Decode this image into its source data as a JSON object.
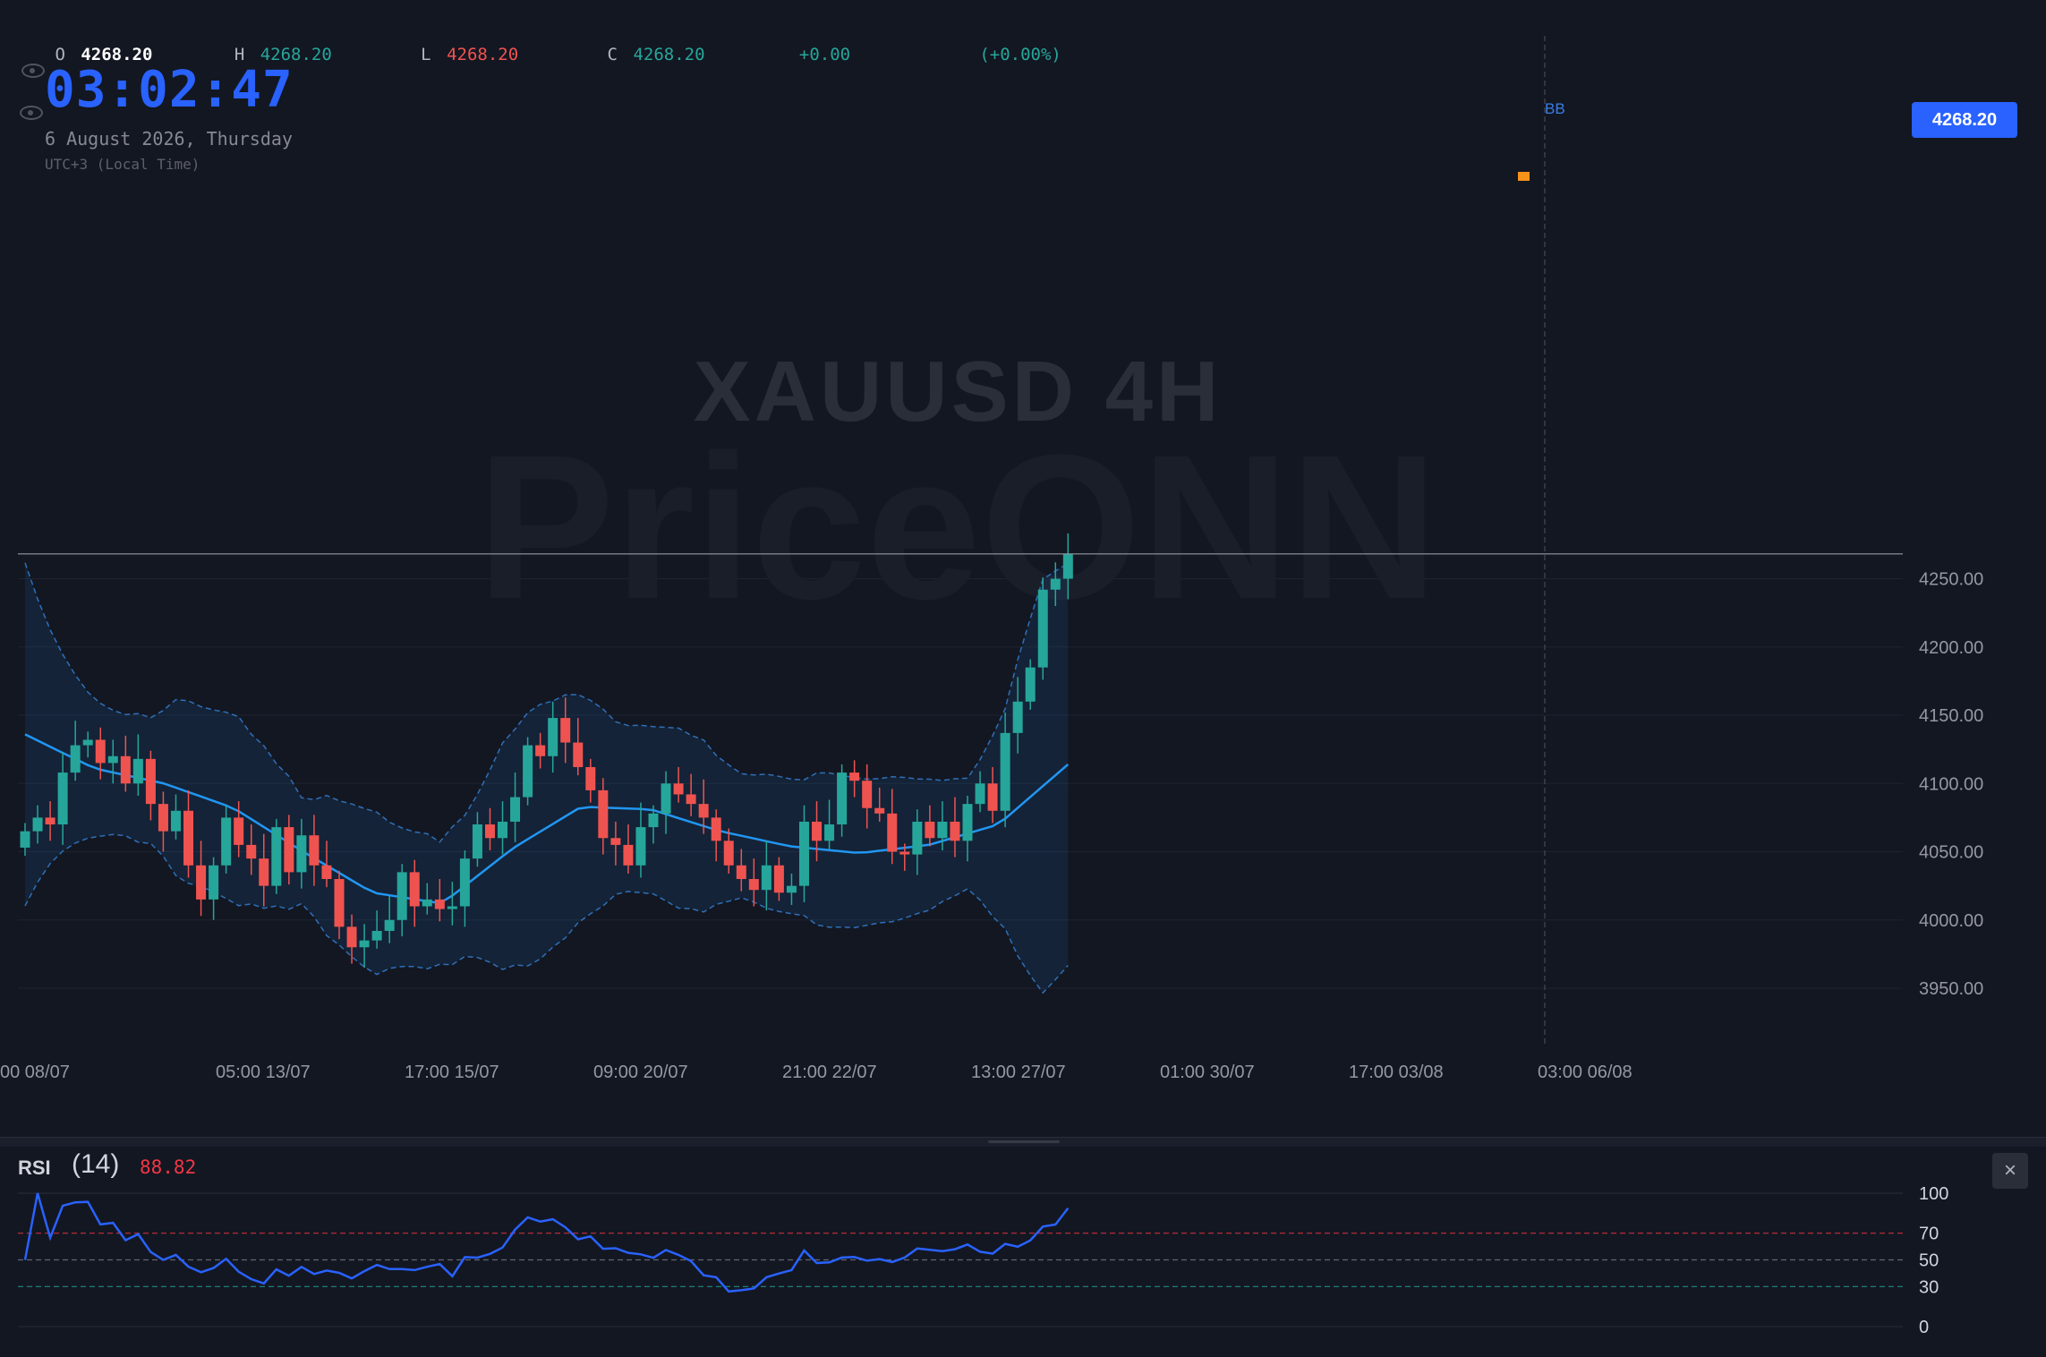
{
  "ohlc": {
    "o_label": "O",
    "o_value": "4268.20",
    "h_label": "H",
    "h_value": "4268.20",
    "l_label": "L",
    "l_value": "4268.20",
    "c_label": "C",
    "c_value": "4268.20",
    "change": "+0.00",
    "change_pct": "(+0.00%)"
  },
  "clock": "03:02:47",
  "date_line": "6 August 2026, Thursday",
  "timezone_line": "UTC+3 (Local Time)",
  "watermark": {
    "symbol": "XAUUSD 4H",
    "brand": "PriceONN"
  },
  "current_price_tag": "4268.20",
  "indicator_label": "BB",
  "rsi": {
    "label": "RSI",
    "length": "(14)",
    "value": "88.82"
  },
  "close_icon": "×",
  "colors": {
    "up": "#26a69a",
    "down": "#ef5350",
    "accent": "#2962ff",
    "rsi_line": "#2962ff",
    "basis": "#2196f3"
  },
  "chart_data": [
    {
      "type": "candlestick",
      "symbol": "XAUUSD",
      "timeframe": "4H",
      "ylim": [
        3925,
        4290
      ],
      "y_ticks": [
        3950,
        4000,
        4050,
        4100,
        4150,
        4200,
        4250
      ],
      "y_tick_labels": [
        "3950.00",
        "4000.00",
        "4050.00",
        "4100.00",
        "4150.00",
        "4200.00",
        "4250.00"
      ],
      "x_tick_labels": [
        "00 08/07",
        "05:00 13/07",
        "17:00 15/07",
        "09:00 20/07",
        "21:00 22/07",
        "13:00 27/07",
        "01:00 30/07",
        "17:00 03/08",
        "03:00 06/08"
      ],
      "last_price": 4268.2,
      "bollinger": {
        "basis": [
          4136,
          4111,
          4100,
          4082,
          4050,
          4020,
          4012,
          4052,
          4083,
          4081,
          4065,
          4054,
          4049,
          4055,
          4070,
          4114
        ]
      },
      "closes": [
        4065,
        4075,
        4070,
        4108,
        4128,
        4132,
        4115,
        4120,
        4100,
        4118,
        4085,
        4065,
        4080,
        4040,
        4015,
        4040,
        4075,
        4055,
        4045,
        4025,
        4068,
        4035,
        4062,
        4040,
        4030,
        3995,
        3980,
        3985,
        3992,
        4000,
        4035,
        4010,
        4015,
        4008,
        4010,
        4045,
        4070,
        4060,
        4072,
        4090,
        4128,
        4120,
        4148,
        4130,
        4112,
        4095,
        4060,
        4055,
        4040,
        4068,
        4078,
        4100,
        4092,
        4085,
        4075,
        4058,
        4040,
        4030,
        4022,
        4040,
        4020,
        4025,
        4072,
        4058,
        4070,
        4108,
        4102,
        4082,
        4078,
        4050,
        4048,
        4072,
        4060,
        4072,
        4058,
        4085,
        4100,
        4080,
        4137,
        4160,
        4185,
        4242,
        4250,
        4268.2
      ],
      "rsi": {
        "overbought": 70,
        "mid": 50,
        "oversold": 30,
        "ticks": [
          100,
          70,
          50,
          30,
          0
        ],
        "last": 88.82
      }
    }
  ]
}
